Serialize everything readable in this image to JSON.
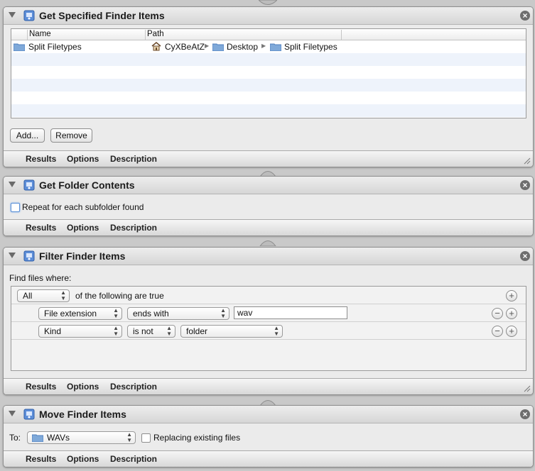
{
  "common": {
    "results": "Results",
    "options": "Options",
    "description": "Description"
  },
  "get_items": {
    "title": "Get Specified Finder Items",
    "columns": [
      "Name",
      "Path"
    ],
    "rows": [
      {
        "name": "Split Filetypes",
        "path": [
          "CyXBeAtZ",
          "Desktop",
          "Split Filetypes"
        ]
      }
    ],
    "add_label": "Add...",
    "remove_label": "Remove"
  },
  "folder_contents": {
    "title": "Get Folder Contents",
    "repeat_label": "Repeat for each subfolder found",
    "repeat_checked": false
  },
  "filter": {
    "title": "Filter Finder Items",
    "find_label": "Find files where:",
    "match_value": "All",
    "match_suffix": "of the following are true",
    "rule1": {
      "field": "File extension",
      "op": "ends with",
      "value": "wav"
    },
    "rule2": {
      "field": "Kind",
      "op": "is not",
      "value": "folder"
    }
  },
  "move": {
    "title": "Move Finder Items",
    "to_label": "To:",
    "to_value": "WAVs",
    "replace_label": "Replacing existing files",
    "replace_checked": false
  },
  "icons": {
    "app": "automator-app-icon",
    "close": "close-icon",
    "disclosure": "disclosure-triangle-icon",
    "folder": "folder-icon",
    "home": "home-icon",
    "path_separator": "path-separator-icon",
    "add": "plus-icon",
    "remove": "minus-icon",
    "resize": "resize-grip-icon"
  },
  "colors": {
    "row_alt": "#eef3fb",
    "folder_blue": "#7fa9d9",
    "header_gray": "#d6d6d6"
  }
}
